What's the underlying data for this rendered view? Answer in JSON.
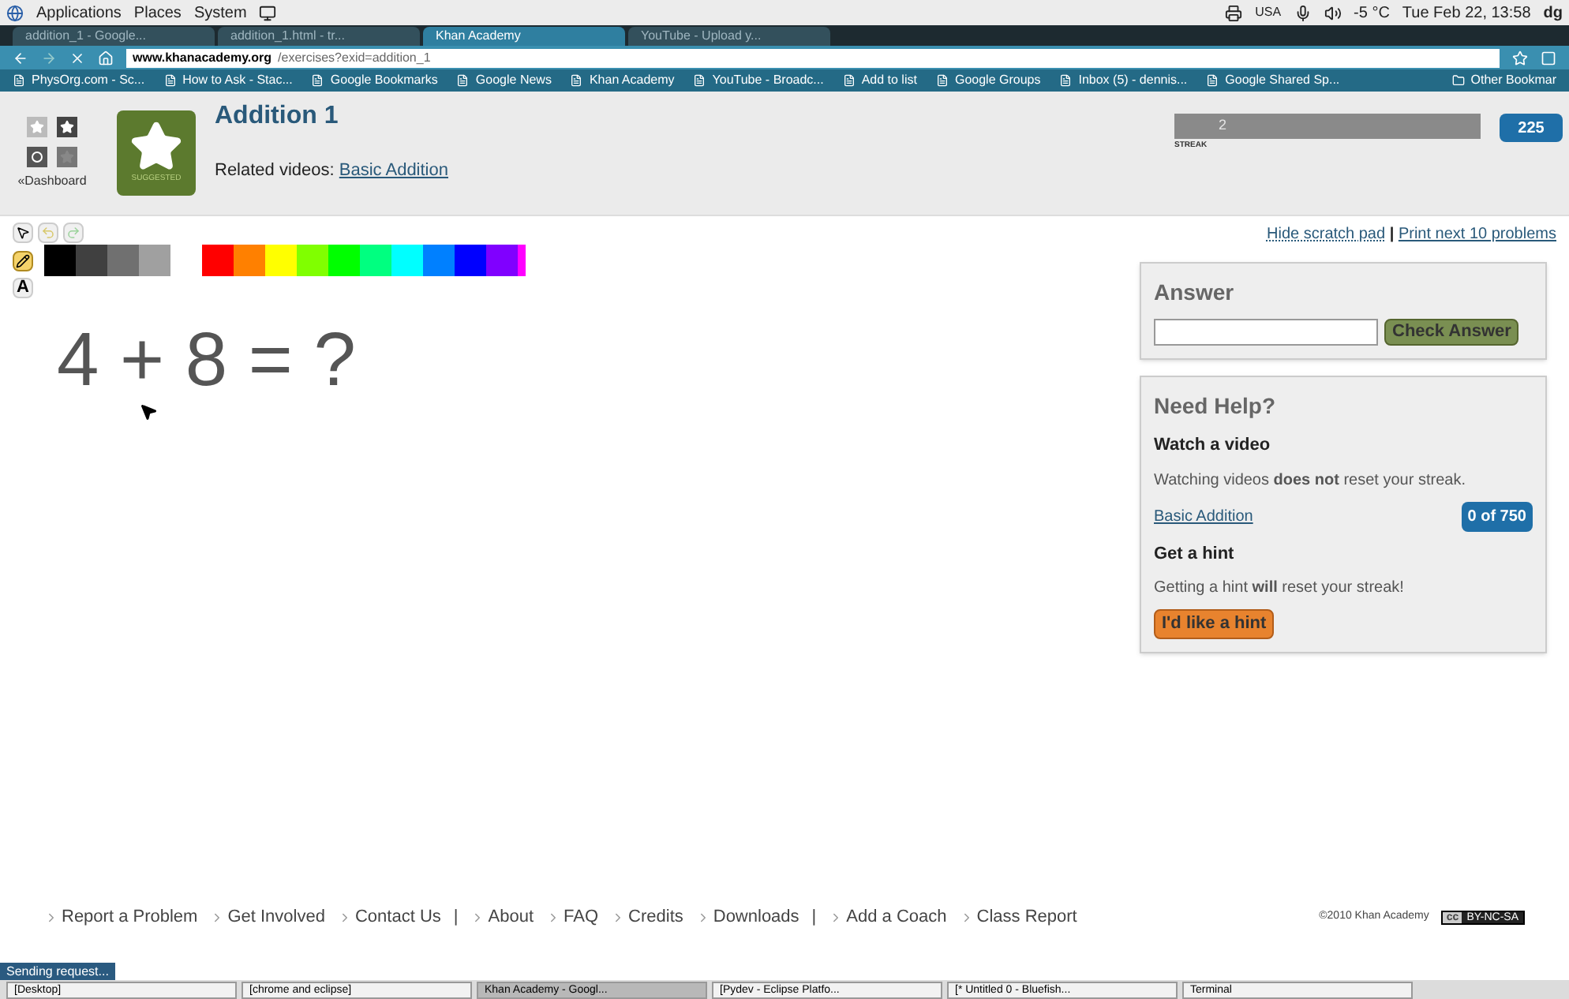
{
  "top_panel": {
    "menus": [
      "Applications",
      "Places",
      "System"
    ],
    "tray": {
      "keyboard": "USA",
      "weather": "-5 °C",
      "clock": "Tue Feb 22, 13:58",
      "user": "dg"
    }
  },
  "tabs": [
    {
      "label": "addition_1 - Google...",
      "selected": false
    },
    {
      "label": "addition_1.html - tr...",
      "selected": false
    },
    {
      "label": "Khan Academy",
      "selected": true
    },
    {
      "label": "YouTube - Upload y...",
      "selected": false
    }
  ],
  "address_bar": {
    "domain": "www.khanacademy.org",
    "path": "/exercises?exid=addition_1"
  },
  "bookmarks": [
    "PhysOrg.com - Sc...",
    "How to Ask - Stac...",
    "Google Bookmarks",
    "Google News",
    "Khan Academy",
    "YouTube - Broadc...",
    "Add to list",
    "Google Groups",
    "Inbox (5) - dennis...",
    "Google Shared Sp..."
  ],
  "other_bookmarks": "Other Bookmar",
  "header": {
    "dashboard_link": "«Dashboard",
    "badge_label": "SUGGESTED",
    "title": "Addition 1",
    "related_label": "Related videos:",
    "related_link": "Basic Addition",
    "streak_value": "2",
    "streak_label": "STREAK",
    "points": "225"
  },
  "scratch_links": {
    "hide": "Hide scratch pad",
    "separator": "|",
    "print": "Print next 10 problems"
  },
  "tools": [
    {
      "kind": "pointer",
      "selected": false
    },
    {
      "kind": "undo",
      "selected": false
    },
    {
      "kind": "redo",
      "selected": false
    },
    {
      "kind": "pencil",
      "selected": true
    },
    {
      "kind": "text",
      "selected": false
    }
  ],
  "text_tool_label": "A",
  "grays": [
    {
      "color": "#000000"
    },
    {
      "color": "#404040"
    },
    {
      "color": "#707070"
    },
    {
      "color": "#a0a0a0"
    }
  ],
  "palette": [
    {
      "color": "#ff0000"
    },
    {
      "color": "#ff8000"
    },
    {
      "color": "#ffff00"
    },
    {
      "color": "#80ff00"
    },
    {
      "color": "#00ff00"
    },
    {
      "color": "#00ff80"
    },
    {
      "color": "#00ffff"
    },
    {
      "color": "#0080ff"
    },
    {
      "color": "#0000ff"
    },
    {
      "color": "#8000ff"
    },
    {
      "color": "#ff00ff"
    }
  ],
  "problem": "4 + 8 = ?",
  "answer": {
    "title": "Answer",
    "button": "Check Answer"
  },
  "help": {
    "title": "Need Help?",
    "video_heading": "Watch a video",
    "video_text": "Watching videos **does not** reset your streak.",
    "video_link": "Basic Addition",
    "video_count": "0 of 750",
    "hint_heading": "Get a hint",
    "hint_text": "Getting a hint **will** reset your streak!",
    "hint_button": "I'd like a hint"
  },
  "footer": {
    "links": [
      {
        "kind": "link",
        "label": "Report a Problem"
      },
      {
        "kind": "link",
        "label": "Get Involved"
      },
      {
        "kind": "link",
        "label": "Contact Us"
      },
      {
        "kind": "separator",
        "label": "|"
      },
      {
        "kind": "link",
        "label": "About"
      },
      {
        "kind": "link",
        "label": "FAQ"
      },
      {
        "kind": "link",
        "label": "Credits"
      },
      {
        "kind": "link",
        "label": "Downloads"
      },
      {
        "kind": "separator",
        "label": "|"
      },
      {
        "kind": "link",
        "label": "Add a Coach"
      },
      {
        "kind": "link",
        "label": "Class Report"
      }
    ],
    "copyright": "©2010 Khan Academy",
    "license_cc": "cc",
    "license": "BY-NC-SA"
  },
  "status_bar": "Sending request...",
  "taskbar": [
    {
      "label": "[Desktop]",
      "selected": false
    },
    {
      "label": "[chrome and eclipse]",
      "selected": false
    },
    {
      "label": "Khan Academy - Googl...",
      "selected": true
    },
    {
      "label": "[Pydev - Eclipse Platfo...",
      "selected": false
    },
    {
      "label": "[* Untitled 0 - Bluefish...",
      "selected": false
    },
    {
      "label": "Terminal",
      "selected": false
    }
  ]
}
